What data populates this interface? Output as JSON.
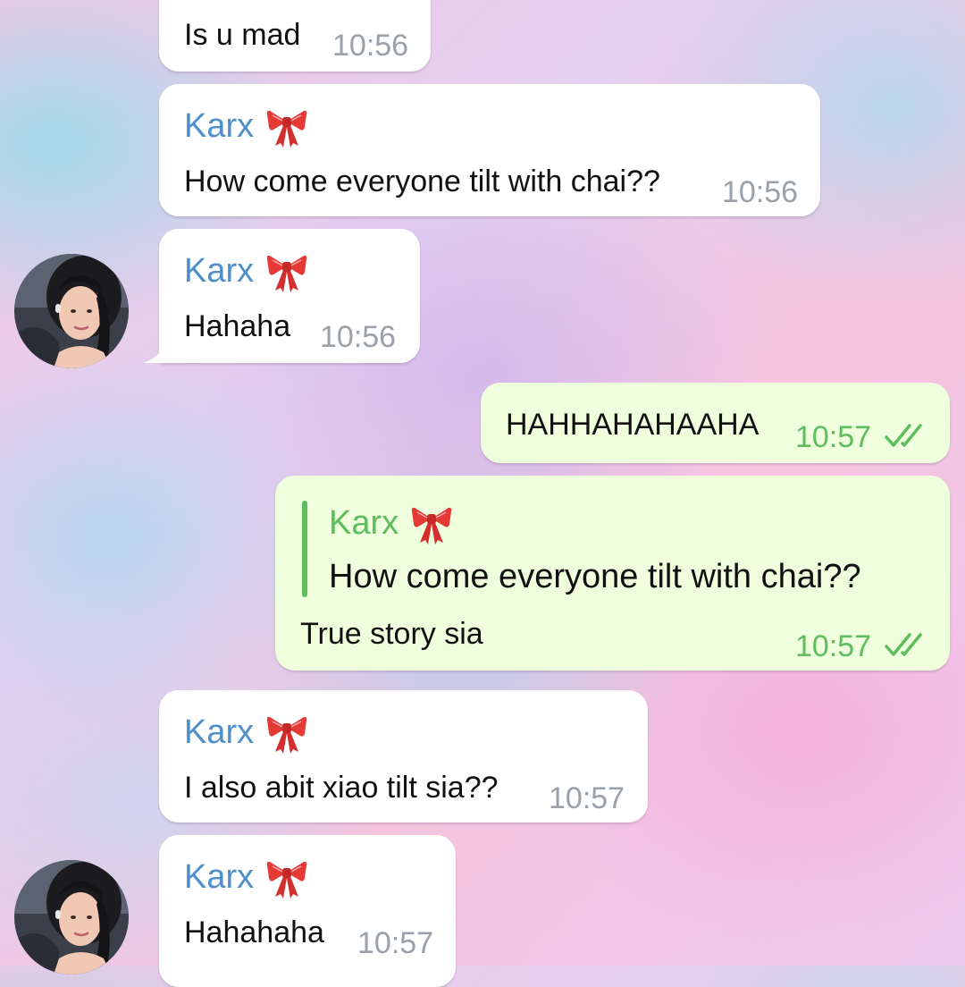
{
  "messages": [
    {
      "text": "Is u mad",
      "time": "10:56"
    },
    {
      "sender": "Karx",
      "sender_emoji": "bow-icon",
      "text": "How come everyone tilt with chai??",
      "time": "10:56"
    },
    {
      "sender": "Karx",
      "sender_emoji": "bow-icon",
      "text": "Hahaha",
      "time": "10:56"
    },
    {
      "text": "HAHHAHAHAAHA",
      "time": "10:57",
      "status": "read"
    },
    {
      "reply_to": {
        "sender": "Karx",
        "text": "How come everyone tilt with chai??"
      },
      "text": "True story sia",
      "time": "10:57",
      "status": "read"
    },
    {
      "sender": "Karx",
      "sender_emoji": "bow-icon",
      "text": "I also abit xiao tilt sia??",
      "time": "10:57"
    },
    {
      "sender": "Karx",
      "sender_emoji": "bow-icon",
      "text": "Hahahaha",
      "time": "10:57"
    }
  ],
  "colors": {
    "incoming_bubble": "#ffffff",
    "outgoing_bubble": "#effedd",
    "sender_name": "#4e8fcc",
    "outgoing_accent": "#5ebd5e",
    "timestamp_incoming": "#9aa1a8"
  }
}
